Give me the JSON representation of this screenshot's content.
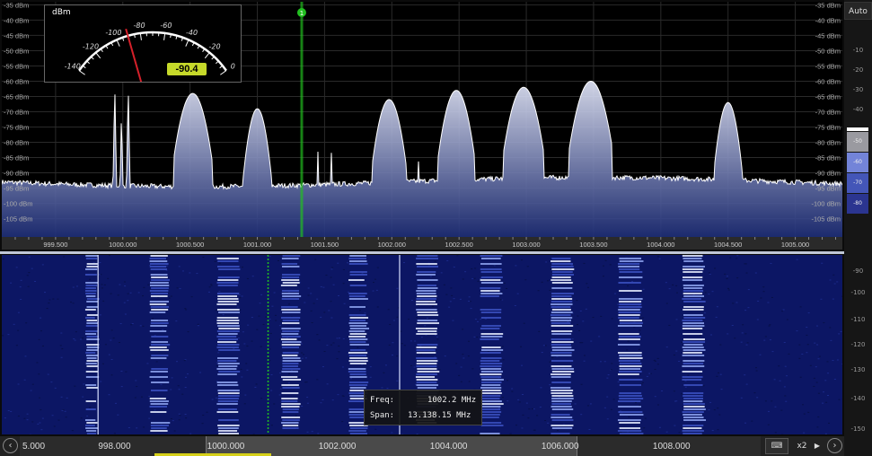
{
  "spectrum": {
    "level_labels": [
      "-35 dBm",
      "-40 dBm",
      "-45 dBm",
      "-50 dBm",
      "-55 dBm",
      "-60 dBm",
      "-65 dBm",
      "-70 dBm",
      "-75 dBm",
      "-80 dBm",
      "-85 dBm",
      "-90 dBm",
      "-95 dBm",
      "-100 dBm",
      "-105 dBm"
    ],
    "level_values": [
      -35,
      -40,
      -45,
      -50,
      -55,
      -60,
      -65,
      -70,
      -75,
      -80,
      -85,
      -90,
      -95,
      -100,
      -105
    ],
    "freq_labels": [
      "999.500",
      "1000.000",
      "1000.500",
      "1001.000",
      "1001.500",
      "1002.000",
      "1002.500",
      "1003.000",
      "1003.500",
      "1004.000",
      "1004.500",
      "1005.000"
    ],
    "freq_values": [
      999.5,
      1000.0,
      1000.5,
      1001.0,
      1001.5,
      1002.0,
      1002.5,
      1003.0,
      1003.5,
      1004.0,
      1004.5,
      1005.0
    ],
    "freq_range_mhz": [
      999.1,
      1005.35
    ],
    "level_range_dbm": [
      -34,
      -111
    ],
    "noise_floor_dbm": -93,
    "marker_freq_mhz": 1001.33,
    "marker_label": "1",
    "signals": [
      {
        "center": 1000.0,
        "width": 0.05,
        "peak": -69,
        "type": "narrow-triple"
      },
      {
        "center": 1000.52,
        "width": 0.18,
        "peak": -68,
        "type": "wide"
      },
      {
        "center": 1001.0,
        "width": 0.13,
        "peak": -73,
        "type": "wide"
      },
      {
        "center": 1001.5,
        "width": 0.04,
        "peak": -82,
        "type": "narrow-double"
      },
      {
        "center": 1001.98,
        "width": 0.16,
        "peak": -70,
        "type": "wide"
      },
      {
        "center": 1002.2,
        "width": 0.04,
        "peak": -82,
        "type": "narrow"
      },
      {
        "center": 1002.48,
        "width": 0.17,
        "peak": -67,
        "type": "wide"
      },
      {
        "center": 1002.98,
        "width": 0.19,
        "peak": -66,
        "type": "wide"
      },
      {
        "center": 1003.48,
        "width": 0.2,
        "peak": -64,
        "type": "wide"
      },
      {
        "center": 1003.98,
        "width": 0.04,
        "peak": -86,
        "type": "narrow-double"
      },
      {
        "center": 1004.5,
        "width": 0.13,
        "peak": -71,
        "type": "wide"
      }
    ],
    "colors": {
      "fill_top": "#e8ecff",
      "fill_bottom": "#1f2f7a",
      "trace": "#ffffff",
      "marker": "#22c020",
      "grid": "#2a2a2a"
    }
  },
  "right_scale": {
    "auto_label": "Auto",
    "upper_ticks": [
      "-10",
      "-20",
      "-30",
      "-40",
      "-50",
      "-60",
      "-70"
    ],
    "colorbar_labels": [
      "-40",
      "-50",
      "-60",
      "-70",
      "-80"
    ],
    "colorbar_colors": [
      "#ffffff",
      "#9a9aa0",
      "#7384d8",
      "#4456b8",
      "#2b3590"
    ],
    "lower_ticks": [
      "-90",
      "-100",
      "-110",
      "-120",
      "-130",
      "-140",
      "-150"
    ]
  },
  "smeter": {
    "unit": "dBm",
    "scale_labels": [
      "-140",
      "-120",
      "-100",
      "-80",
      "-60",
      "-40",
      "-20",
      "0"
    ],
    "scale_values": [
      -140,
      -120,
      -100,
      -80,
      -60,
      -40,
      -20,
      0
    ],
    "value_text": "-90.4",
    "value": -90.4
  },
  "waterfall": {
    "freq_range_mhz": [
      996.5,
      1009.6
    ],
    "bands": [
      {
        "x": 997.8,
        "w": 0.2,
        "intensity": 0.8
      },
      {
        "x": 998.8,
        "w": 0.3,
        "intensity": 0.9
      },
      {
        "x": 999.85,
        "w": 0.35,
        "intensity": 0.9
      },
      {
        "x": 1000.85,
        "w": 0.3,
        "intensity": 0.85
      },
      {
        "x": 1001.9,
        "w": 0.3,
        "intensity": 0.75
      },
      {
        "x": 1002.95,
        "w": 0.35,
        "intensity": 0.9
      },
      {
        "x": 1003.95,
        "w": 0.35,
        "intensity": 0.9
      },
      {
        "x": 1005.05,
        "w": 0.35,
        "intensity": 0.9
      },
      {
        "x": 1006.1,
        "w": 0.38,
        "intensity": 0.85
      },
      {
        "x": 1007.1,
        "w": 0.35,
        "intensity": 0.9
      }
    ],
    "carrier_lines": [
      998.0,
      1002.7
    ],
    "marker_line": 1000.65
  },
  "bottom": {
    "freq_labels": [
      "5.000",
      "998.000",
      "1000.000",
      "1002.000",
      "1004.000",
      "1006.000",
      "1008.000"
    ],
    "freq_values": [
      996.55,
      998.0,
      1000.0,
      1002.0,
      1004.0,
      1006.0,
      1008.0
    ],
    "zoom_label": "x2",
    "keyboard_icon": "keyboard-icon",
    "left_icon": "chevron-left-icon",
    "right_icon": "chevron-right-icon"
  },
  "tooltip": {
    "freq_label": "Freq:",
    "freq_value": "1002.2 MHz",
    "span_label": "Span:",
    "span_value": "13.138.15 MHz"
  }
}
